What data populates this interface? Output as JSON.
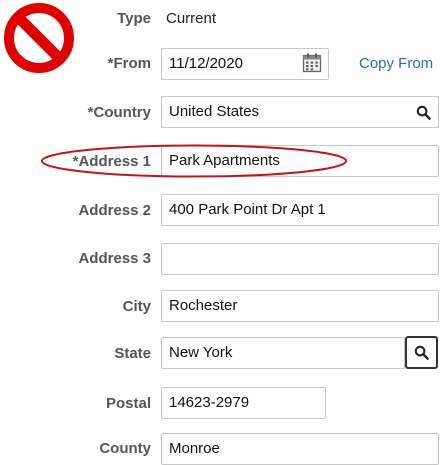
{
  "overlay": {
    "prohibit_icon": "no-symbol-icon",
    "highlight_color": "#cc1111"
  },
  "form": {
    "type": {
      "label": "Type",
      "value": "Current"
    },
    "from": {
      "label": "*From",
      "value": "11/12/2020",
      "icon": "calendar-icon"
    },
    "copy_from": {
      "label": "Copy From"
    },
    "country": {
      "label": "*Country",
      "value": "United States",
      "icon": "search-icon"
    },
    "address1": {
      "label": "*Address 1",
      "value": "Park Apartments"
    },
    "address2": {
      "label": "Address 2",
      "value": "400 Park Point Dr Apt 1"
    },
    "address3": {
      "label": "Address 3",
      "value": ""
    },
    "city": {
      "label": "City",
      "value": "Rochester"
    },
    "state": {
      "label": "State",
      "value": "New York",
      "icon": "search-icon"
    },
    "postal": {
      "label": "Postal",
      "value": "14623-2979"
    },
    "county": {
      "label": "County",
      "value": "Monroe"
    }
  }
}
